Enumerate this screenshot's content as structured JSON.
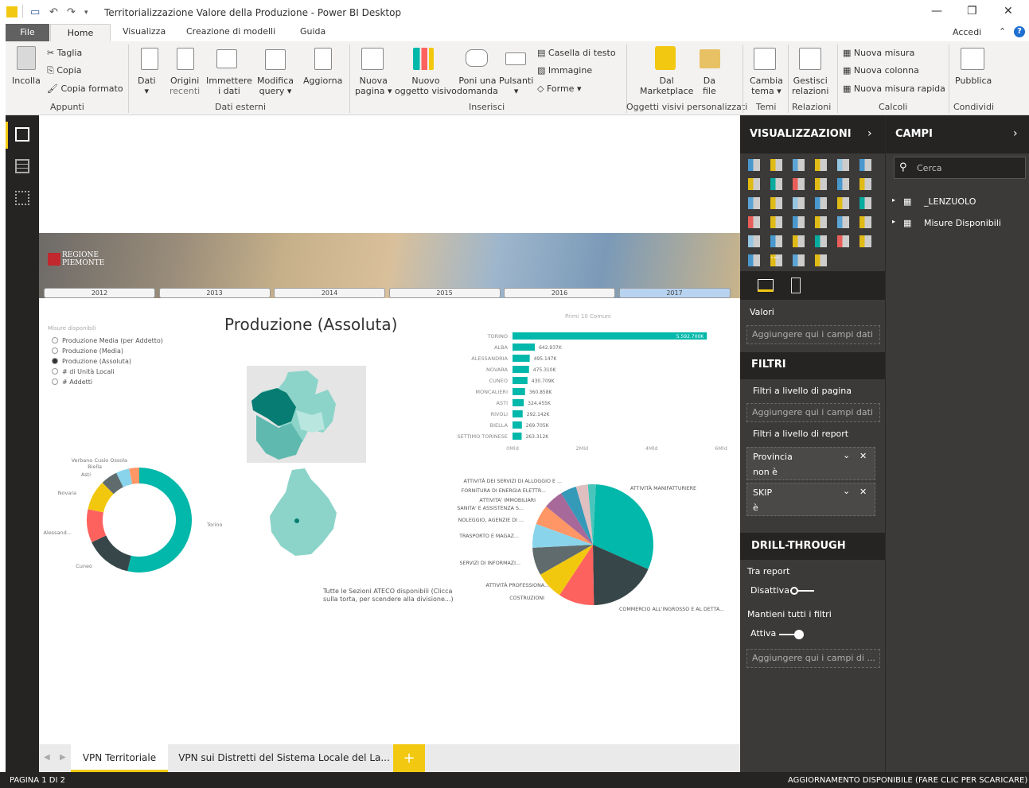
{
  "window": {
    "title": "Territorializzazione Valore della Produzione - Power BI Desktop",
    "signin": "Accedi"
  },
  "tabs": [
    "File",
    "Home",
    "Visualizza",
    "Creazione di modelli",
    "Guida"
  ],
  "ribbon": {
    "incolla": "Incolla",
    "taglia": "Taglia",
    "copia": "Copia",
    "copia_formato": "Copia formato",
    "appunti": "Appunti",
    "dati": "Dati",
    "origini": "Origini",
    "recenti": "recenti",
    "immettere": "Immettere",
    "i_dati": "i dati",
    "modifica": "Modifica",
    "query": "query",
    "aggiorna": "Aggiorna",
    "dati_esterni": "Dati esterni",
    "nuova": "Nuova",
    "pagina": "pagina",
    "nuovo": "Nuovo",
    "oggetto_visivo": "oggetto visivo",
    "poni_una": "Poni una",
    "domanda": "domanda",
    "pulsanti": "Pulsanti",
    "casella": "Casella di testo",
    "immagine": "Immagine",
    "forme": "Forme",
    "inserisci": "Inserisci",
    "dal": "Dal",
    "marketplace": "Marketplace",
    "da": "Da",
    "file": "file",
    "oggetti": "Oggetti visivi personalizzati",
    "cambia": "Cambia",
    "tema": "tema",
    "temi": "Temi",
    "gestisci": "Gestisci",
    "relazioni_btn": "relazioni",
    "relazioni": "Relazioni",
    "nuova_misura": "Nuova misura",
    "nuova_colonna": "Nuova colonna",
    "nuova_misura_rapida": "Nuova misura rapida",
    "calcoli": "Calcoli",
    "pubblica": "Pubblica",
    "condividi": "Condividi"
  },
  "report": {
    "title": "Produzione (Assoluta)",
    "logo1": "REGIONE",
    "logo2": "PIEMONTE",
    "years": [
      "2012",
      "2013",
      "2014",
      "2015",
      "2016",
      "2017"
    ],
    "selected_year": "2017",
    "misure_label": "Misure disponibili",
    "misure": [
      "Produzione Media (per Addetto)",
      "Produzione (Media)",
      "Produzione (Assoluta)",
      "# di Unità Locali",
      "# Addetti"
    ],
    "misure_selected": 2,
    "bar_title": "Primi 10 Comuni",
    "bar_axis": [
      "0Mld",
      "2Mld",
      "4Mld",
      "6Mld"
    ],
    "donut_labels": [
      "Verbano Cusio Ossola",
      "Biella",
      "Asti",
      "Novara",
      "Alessand...",
      "Cuneo",
      "Torino"
    ],
    "pie_labels": [
      "ATTIVITÀ DEI SERVIZI DI ALLOGGIO E ...",
      "FORNITURA DI ENERGIA ELETTR...",
      "ATTIVITA' IMMOBILIARI",
      "SANITA' E ASSISTENZA S...",
      "NOLEGGIO, AGENZIE DI ...",
      "TRASPORTO E MAGAZ...",
      "SERVIZI DI INFORMAZI...",
      "ATTIVITÀ PROFESSIONA...",
      "COSTRUZIONI",
      "COMMERCIO ALL'INGROSSO E AL DETTA...",
      "ATTIVITÀ MANIFATTURIERE"
    ],
    "pie_note1": "Tutte le Sezioni ATECO disponibili (Clicca",
    "pie_note2": "sulla torta, per scendere alla divisione...)"
  },
  "chart_data": [
    {
      "type": "bar",
      "title": "Primi 10 Comuni",
      "categories": [
        "TORINO",
        "ALBA",
        "ALESSANDRIA",
        "NOVARA",
        "CUNEO",
        "MONCALIERI",
        "ASTI",
        "RIVOLI",
        "BIELLA",
        "SETTIMO TORINESE"
      ],
      "value_labels": [
        "5.592.700K",
        "642.937K",
        "495.147K",
        "475.310K",
        "430.709K",
        "360.858K",
        "324.455K",
        "292.142K",
        "269.705K",
        "263.312K"
      ],
      "values": [
        5592700,
        642937,
        495147,
        475310,
        430709,
        360858,
        324455,
        292142,
        269705,
        263312
      ],
      "xlim": [
        0,
        6000000
      ]
    },
    {
      "type": "pie",
      "categories": [
        "Torino",
        "Cuneo",
        "Alessand...",
        "Novara",
        "Asti",
        "Biella",
        "Verbano Cusio Ossola"
      ],
      "values": [
        52,
        14,
        10,
        9,
        5,
        4,
        3
      ],
      "colors": [
        "#01b8aa",
        "#374649",
        "#fd625e",
        "#f2c80f",
        "#5f6b6d",
        "#8ad4eb",
        "#fe9666"
      ]
    },
    {
      "type": "pie",
      "categories": [
        "ATTIVITÀ MANIFATTURIERE",
        "COMMERCIO ALL'INGROSSO E AL DETTA...",
        "COSTRUZIONI",
        "ATTIVITÀ PROFESSIONA...",
        "SERVIZI DI INFORMAZI...",
        "TRASPORTO E MAGAZ...",
        "NOLEGGIO, AGENZIE DI ...",
        "SANITA' E ASSISTENZA S...",
        "ATTIVITA' IMMOBILIARI",
        "FORNITURA DI ENERGIA ELETTR...",
        "ATTIVITÀ DEI SERVIZI DI ALLOGGIO E ..."
      ],
      "values": [
        29,
        17,
        9,
        7,
        7,
        6,
        5,
        5,
        4,
        3,
        2
      ],
      "colors": [
        "#01b8aa",
        "#374649",
        "#fd625e",
        "#f2c80f",
        "#5f6b6d",
        "#8ad4eb",
        "#fe9666",
        "#a66999",
        "#3599b8",
        "#dfbfbf",
        "#4ac5bb"
      ]
    }
  ],
  "viz": {
    "header": "VISUALIZZAZIONI",
    "valori": "Valori",
    "add": "Aggiungere qui i campi dati",
    "filtri": "FILTRI",
    "filtri_pagina": "Filtri a livello di pagina",
    "filtri_report": "Filtri a livello di report",
    "filter1_name": "Provincia",
    "filter1_val": "non è",
    "filter2_name": "SKIP",
    "filter2_val": "è",
    "drill": "DRILL-THROUGH",
    "tra_report": "Tra report",
    "disattiva": "Disattiva",
    "mantieni": "Mantieni tutti i filtri",
    "attiva": "Attiva",
    "add_short": "Aggiungere qui i campi di ..."
  },
  "campi": {
    "header": "CAMPI",
    "search": "Cerca",
    "tables": [
      "_LENZUOLO",
      "Misure Disponibili"
    ]
  },
  "pagetabs": [
    "VPN Territoriale",
    "VPN sui Distretti del Sistema Locale del La..."
  ],
  "add_page": "+",
  "status": {
    "left": "PAGINA 1 DI 2",
    "right": "AGGIORNAMENTO DISPONIBILE (FARE CLIC PER SCARICARE)"
  }
}
